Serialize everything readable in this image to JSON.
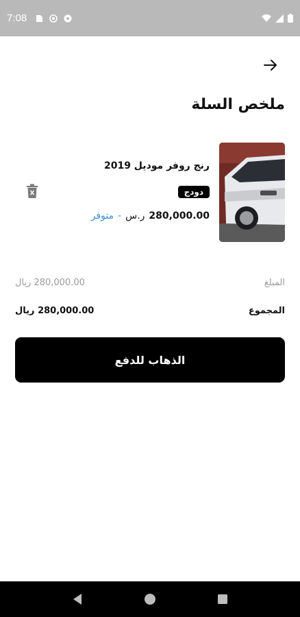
{
  "status_bar": {
    "time": "7:08",
    "left_icons": [
      "sim-card-icon",
      "at-sign-icon",
      "notification-icon"
    ],
    "right_icons": [
      "wifi-icon",
      "signal-icon",
      "battery-icon"
    ]
  },
  "header": {
    "back_icon": "arrow-right-icon",
    "title": "ملخص السلة"
  },
  "cart": {
    "items": [
      {
        "name": "رنج روفر موديل 2019",
        "tag": "دودج",
        "price": "280,000.00",
        "currency": "ر.س",
        "separator": "-",
        "stock_status": "متوفر",
        "image_icon": "car-photo",
        "delete_icon": "trash-icon"
      }
    ]
  },
  "summary": {
    "amount_label": "المبلغ",
    "amount_value": "280,000.00 ريال",
    "total_label": "المجموع",
    "total_value": "280,000.00 ريال"
  },
  "checkout": {
    "label": "الذهاب للدفع"
  },
  "nav": {
    "icons": [
      "back-triangle-icon",
      "home-circle-icon",
      "recents-square-icon"
    ]
  },
  "colors": {
    "status_bar": "#b9b9b9",
    "accent_blue": "#3a8fd8",
    "button_bg": "#000000",
    "muted_text": "#9a9a9a"
  }
}
